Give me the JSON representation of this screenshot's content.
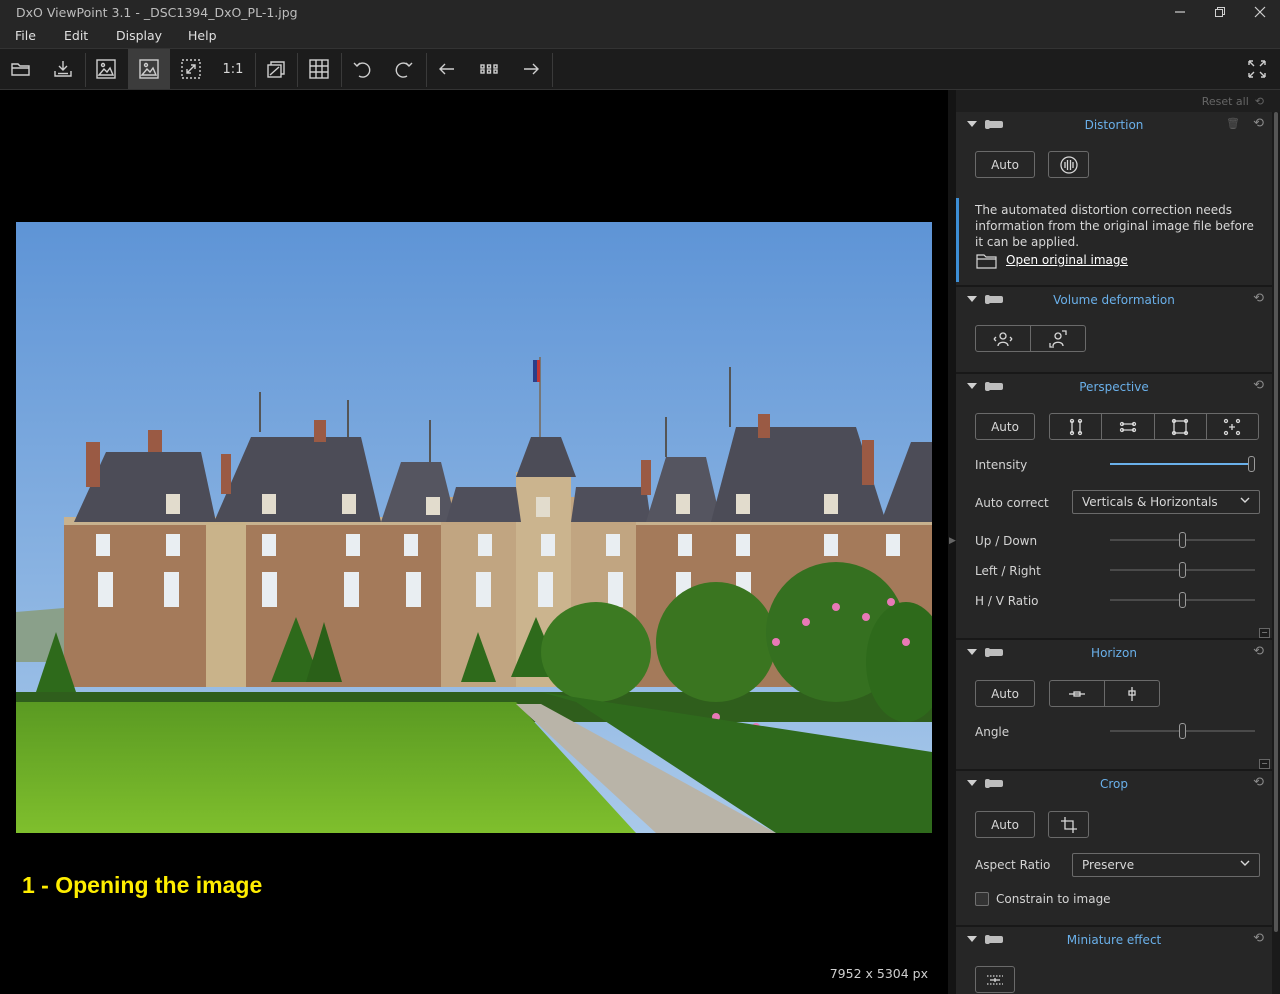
{
  "window": {
    "title": "DxO ViewPoint 3.1 - _DSC1394_DxO_PL-1.jpg"
  },
  "menu": [
    "File",
    "Edit",
    "Display",
    "Help"
  ],
  "toolbar": {
    "one_to_one": "1:1"
  },
  "viewer": {
    "overlay_caption": "1 - Opening the image",
    "dimensions": "7952 x 5304 px"
  },
  "panel": {
    "reset_all": "Reset all",
    "distortion": {
      "title": "Distortion",
      "auto": "Auto",
      "info": "The automated distortion correction needs information from the original image file before it can be applied.",
      "open_link": "Open original image"
    },
    "volume": {
      "title": "Volume deformation"
    },
    "perspective": {
      "title": "Perspective",
      "auto": "Auto",
      "intensity_label": "Intensity",
      "intensity_value": 1.0,
      "auto_correct_label": "Auto correct",
      "auto_correct_value": "Verticals & Horizontals",
      "updown_label": "Up / Down",
      "updown_value": 0,
      "leftright_label": "Left / Right",
      "leftright_value": 0,
      "hvratio_label": "H / V Ratio",
      "hvratio_value": 0
    },
    "horizon": {
      "title": "Horizon",
      "auto": "Auto",
      "angle_label": "Angle",
      "angle_value": 0
    },
    "crop": {
      "title": "Crop",
      "auto": "Auto",
      "aspect_label": "Aspect Ratio",
      "aspect_value": "Preserve",
      "constrain_label": "Constrain to image",
      "constrain_checked": false
    },
    "miniature": {
      "title": "Miniature effect"
    }
  }
}
